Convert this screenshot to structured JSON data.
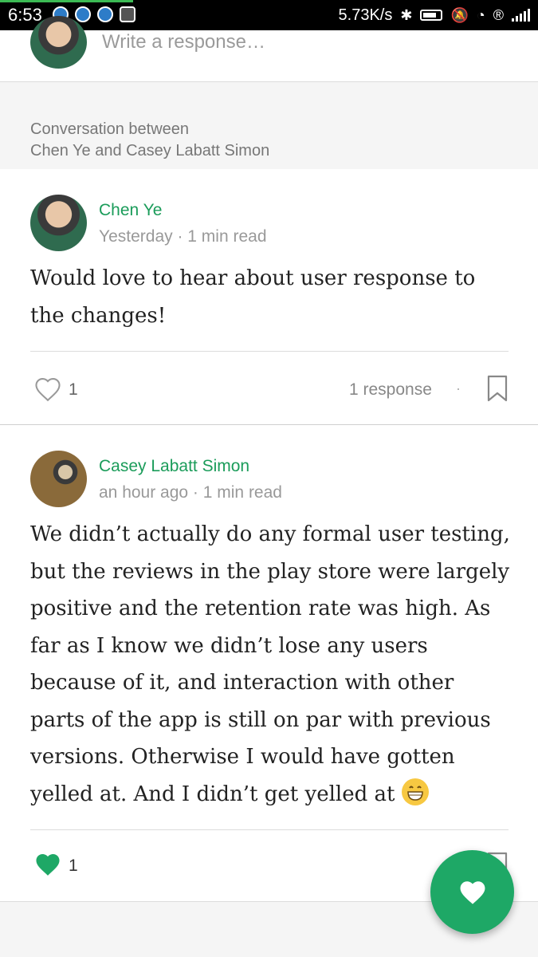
{
  "status_bar": {
    "time": "6:53",
    "network_speed": "5.73K/s",
    "icons": [
      "notification-icon",
      "notification-icon",
      "notification-icon",
      "screenshot-icon",
      "bluetooth-icon",
      "battery-icon",
      "mute-icon",
      "wifi-icon",
      "registered-icon",
      "signal-icon"
    ]
  },
  "response_bar": {
    "placeholder": "Write a response…"
  },
  "conversation": {
    "header_line1": "Conversation between",
    "header_line2": "Chen Ye and Casey Labatt Simon"
  },
  "posts": [
    {
      "author": "Chen Ye",
      "meta": "Yesterday · 1 min read",
      "body": "Would love to hear about user response to the changes!",
      "likes": "1",
      "liked": false,
      "responses": "1 response",
      "separator": "·"
    },
    {
      "author": "Casey Labatt Simon",
      "meta": "an hour ago · 1 min read",
      "body": "We didn’t actually do any formal user testing, but the reviews in the play store were largely positive and the retention rate was high. As far as I know we didn’t lose any users because of it, and interaction with other parts of the app is still on par with previous versions. Otherwise I would have gotten yelled at. And I didn’t get yelled at",
      "emoji": "grinning-face",
      "likes": "1",
      "liked": true
    }
  ],
  "colors": {
    "accent": "#1b9c5a",
    "fab": "#1ea866"
  }
}
